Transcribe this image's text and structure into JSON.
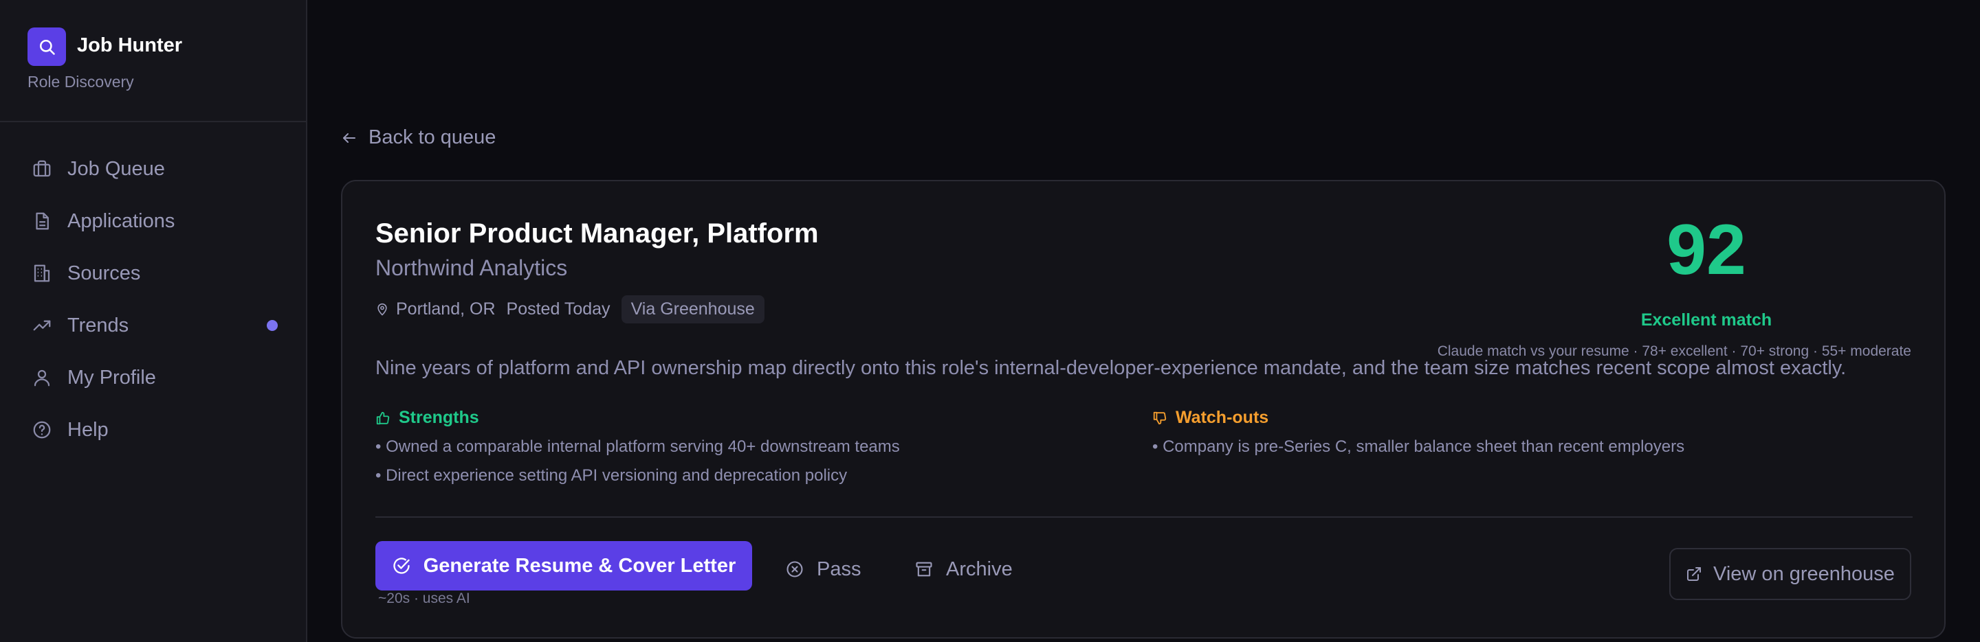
{
  "sidebar": {
    "brand_title": "Job Hunter",
    "brand_subtitle": "Role Discovery",
    "items": [
      {
        "label": "Job Queue",
        "icon": "briefcase-icon"
      },
      {
        "label": "Applications",
        "icon": "document-icon"
      },
      {
        "label": "Sources",
        "icon": "building-icon"
      },
      {
        "label": "Trends",
        "icon": "trending-up-icon",
        "has_dot": true
      },
      {
        "label": "My Profile",
        "icon": "user-icon"
      },
      {
        "label": "Help",
        "icon": "help-circle-icon"
      }
    ]
  },
  "nav": {
    "back_label": "Back to queue"
  },
  "job": {
    "title": "Senior Product Manager, Platform",
    "company": "Northwind Analytics",
    "location": "Portland, OR",
    "posted": "Posted Today",
    "source_badge": "Via Greenhouse",
    "score": "92",
    "score_label": "Excellent match",
    "score_legend": "Claude match vs your resume · 78+ excellent · 70+ strong · 55+ moderate",
    "summary": "Nine years of platform and API ownership map directly onto this role's internal-developer-experience mandate, and the team size matches recent scope almost exactly.",
    "strengths_title": "Strengths",
    "strengths": [
      "• Owned a comparable internal platform serving 40+ downstream teams",
      "• Direct experience setting API versioning and deprecation policy"
    ],
    "watchouts_title": "Watch-outs",
    "watchouts": [
      "• Company is pre-Series C, smaller balance sheet than recent employers"
    ]
  },
  "actions": {
    "generate_label": "Generate Resume & Cover Letter",
    "generate_note": "~20s · uses AI",
    "pass_label": "Pass",
    "archive_label": "Archive",
    "view_label": "View on greenhouse"
  },
  "colors": {
    "accent": "#5b3fe6",
    "score_green": "#1fc98a",
    "watch_orange": "#f59e2e",
    "dot": "#7b73f0"
  }
}
